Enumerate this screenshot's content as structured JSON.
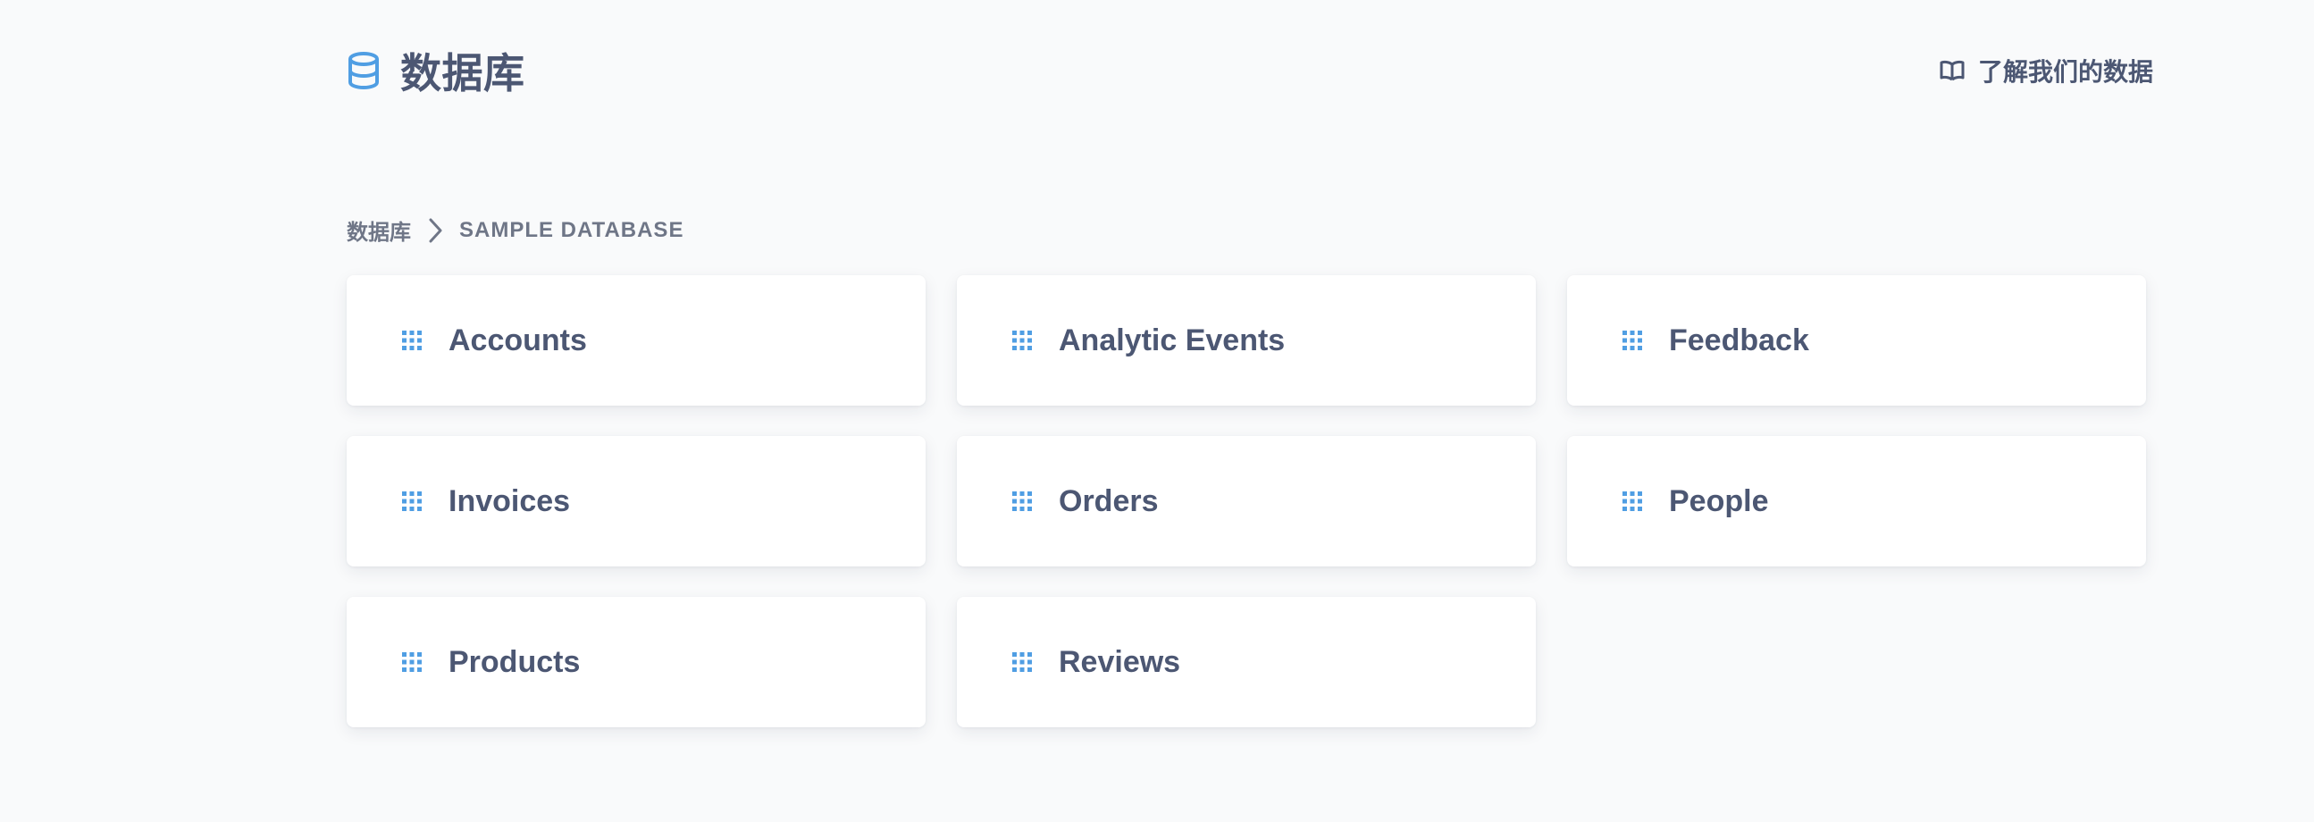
{
  "header": {
    "title": "数据库",
    "icon": "database-icon",
    "learn_link": "了解我们的数据",
    "learn_icon": "book-icon"
  },
  "breadcrumb": {
    "root": "数据库",
    "separator_icon": "chevron-right-icon",
    "current": "Sample Database"
  },
  "tables": [
    {
      "label": "Accounts",
      "icon": "table-grid-icon"
    },
    {
      "label": "Analytic Events",
      "icon": "table-grid-icon"
    },
    {
      "label": "Feedback",
      "icon": "table-grid-icon"
    },
    {
      "label": "Invoices",
      "icon": "table-grid-icon"
    },
    {
      "label": "Orders",
      "icon": "table-grid-icon"
    },
    {
      "label": "People",
      "icon": "table-grid-icon"
    },
    {
      "label": "Products",
      "icon": "table-grid-icon"
    },
    {
      "label": "Reviews",
      "icon": "table-grid-icon"
    }
  ],
  "colors": {
    "accent": "#509ee3",
    "text": "#4c5773",
    "muted_text": "#6f7687",
    "background": "#f9fafb",
    "card": "#ffffff"
  }
}
